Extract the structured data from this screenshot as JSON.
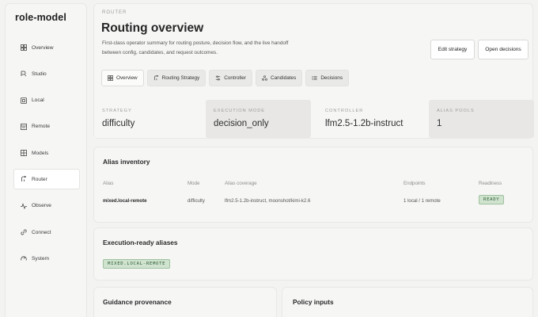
{
  "app": {
    "title": "role-model"
  },
  "sidebar": {
    "items": [
      {
        "label": "Overview",
        "icon": "grid-icon"
      },
      {
        "label": "Studio",
        "icon": "studio-icon"
      },
      {
        "label": "Local",
        "icon": "local-icon"
      },
      {
        "label": "Remote",
        "icon": "remote-icon"
      },
      {
        "label": "Models",
        "icon": "models-icon"
      },
      {
        "label": "Router",
        "icon": "router-icon",
        "active": true
      },
      {
        "label": "Observe",
        "icon": "pulse-icon"
      },
      {
        "label": "Connect",
        "icon": "connect-icon"
      },
      {
        "label": "System",
        "icon": "gauge-icon"
      }
    ]
  },
  "header": {
    "eyebrow": "ROUTER",
    "title": "Routing overview",
    "description": "First-class operator summary for routing posture, decision flow, and the live handoff between config, candidates, and request outcomes.",
    "edit_label": "Edit strategy",
    "open_label": "Open decisions"
  },
  "tabs": [
    {
      "label": "Overview",
      "icon": "grid-icon",
      "active": true
    },
    {
      "label": "Routing Strategy",
      "icon": "router-icon"
    },
    {
      "label": "Controller",
      "icon": "sliders-icon"
    },
    {
      "label": "Candidates",
      "icon": "candidates-icon"
    },
    {
      "label": "Decisions",
      "icon": "list-icon"
    }
  ],
  "stats": [
    {
      "label": "STRATEGY",
      "value": "difficulty"
    },
    {
      "label": "EXECUTION MODE",
      "value": "decision_only"
    },
    {
      "label": "CONTROLLER",
      "value": "lfm2.5-1.2b-instruct"
    },
    {
      "label": "ALIAS POOLS",
      "value": "1"
    }
  ],
  "inventory": {
    "title": "Alias inventory",
    "columns": [
      "Alias",
      "Mode",
      "Alias coverage",
      "Endpoints",
      "Readiness"
    ],
    "rows": [
      {
        "alias": "mixed.local-remote",
        "mode": "difficulty",
        "coverage": "lfm2.5-1.2b-instruct, moonshot/kimi-k2.6",
        "endpoints": "1 local / 1 remote",
        "readiness": "READY"
      }
    ]
  },
  "ready_aliases": {
    "title": "Execution-ready aliases",
    "badge": "MIXED.LOCAL-REMOTE"
  },
  "guidance": {
    "title": "Guidance provenance"
  },
  "policy": {
    "title": "Policy inputs"
  },
  "colors": {
    "ready_bg": "#cfe3cf",
    "ready_border": "#9fc19f",
    "ready_text": "#2f5c33"
  }
}
